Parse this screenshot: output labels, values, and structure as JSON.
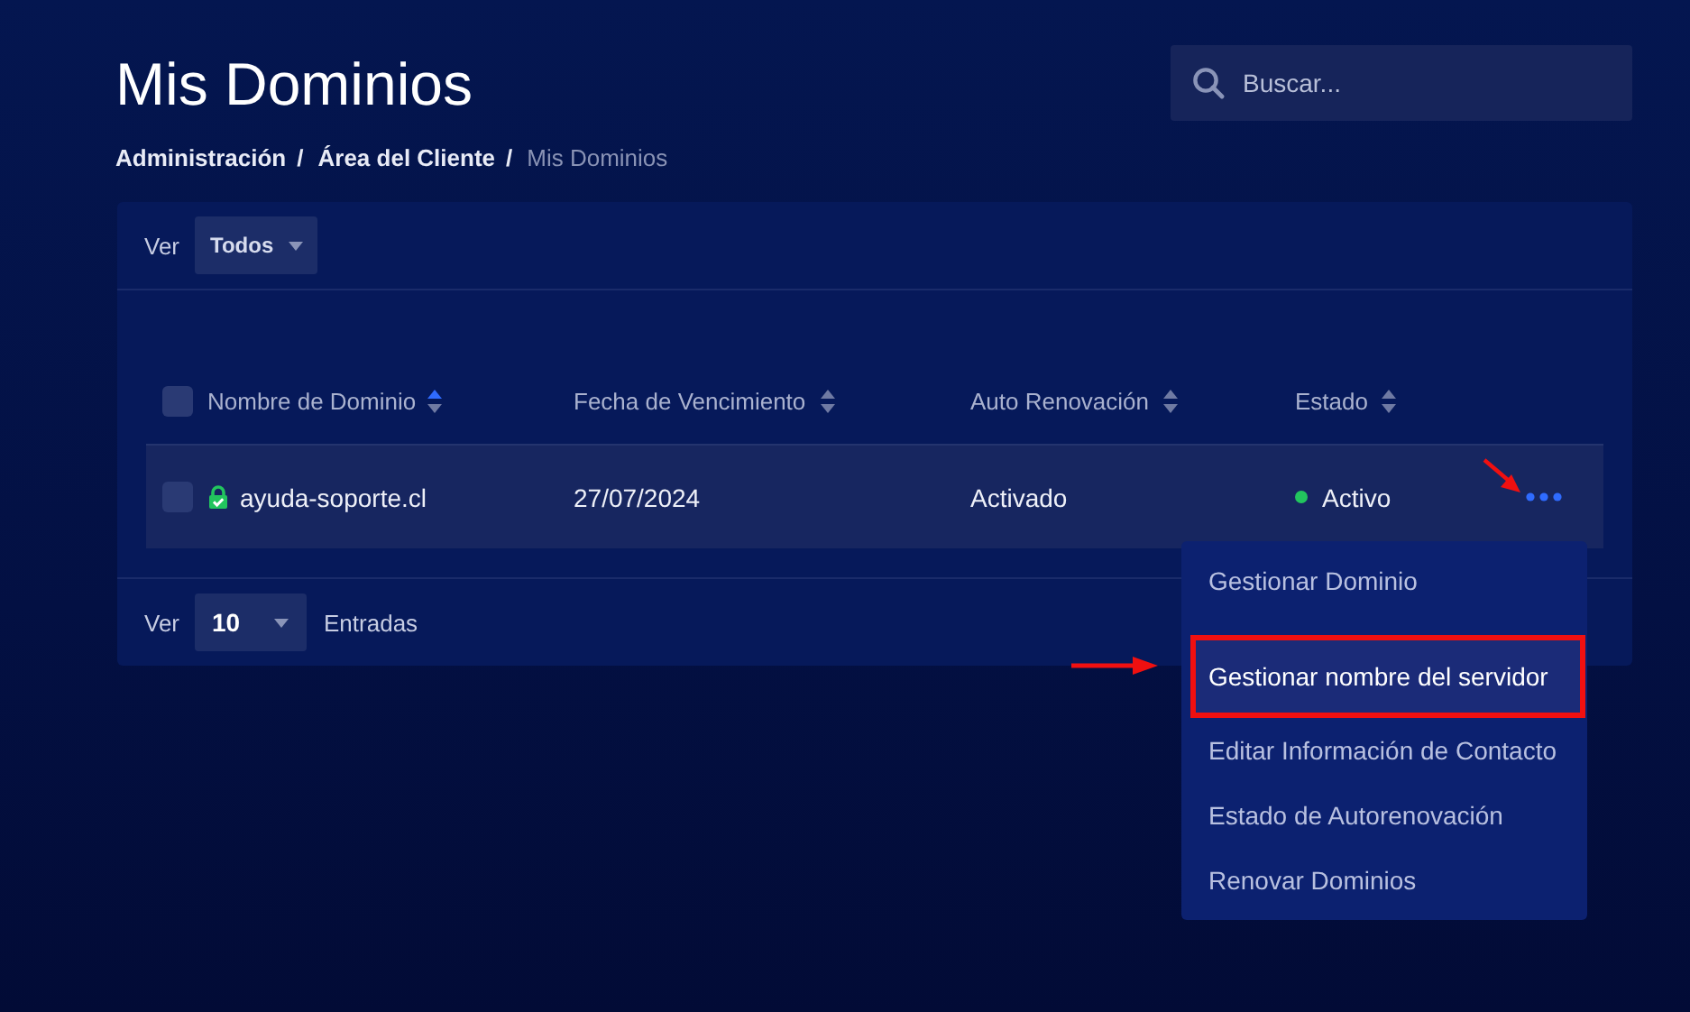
{
  "page": {
    "title": "Mis Dominios",
    "breadcrumb_separator": "/",
    "breadcrumb": [
      {
        "label": "Administración",
        "current": false
      },
      {
        "label": "Área del Cliente",
        "current": false
      },
      {
        "label": "Mis Dominios",
        "current": true
      }
    ]
  },
  "search": {
    "placeholder": "Buscar..."
  },
  "filter": {
    "label": "Ver",
    "value": "Todos"
  },
  "table": {
    "select_all_checked": false,
    "columns": [
      {
        "label": "Nombre de Dominio",
        "sorted": true
      },
      {
        "label": "Fecha de Vencimiento",
        "sorted": false
      },
      {
        "label": "Auto Renovación",
        "sorted": false
      },
      {
        "label": "Estado",
        "sorted": false
      }
    ],
    "rows": [
      {
        "checked": false,
        "secure": true,
        "domain": "ayuda-soporte.cl",
        "expiry": "27/07/2024",
        "auto_renew": "Activado",
        "status": "Activo",
        "color": "#22c55e"
      }
    ]
  },
  "pagination": {
    "label": "Ver",
    "page_size": "10",
    "suffix": "Entradas"
  },
  "action_menu": {
    "open": true,
    "items": [
      {
        "label": "Gestionar Dominio",
        "selected": false,
        "annotated": false
      },
      {
        "label": "Gestionar nombre del servidor",
        "selected": true,
        "annotated": true
      },
      {
        "label": "Editar Información de Contacto",
        "selected": false,
        "annotated": false
      },
      {
        "label": "Estado de Autorenovación",
        "selected": false,
        "annotated": false
      },
      {
        "label": "Renovar Dominios",
        "selected": false,
        "annotated": false
      }
    ]
  },
  "annotations": [
    {
      "kind": "arrow-diagonal"
    },
    {
      "kind": "arrow-right"
    }
  ]
}
